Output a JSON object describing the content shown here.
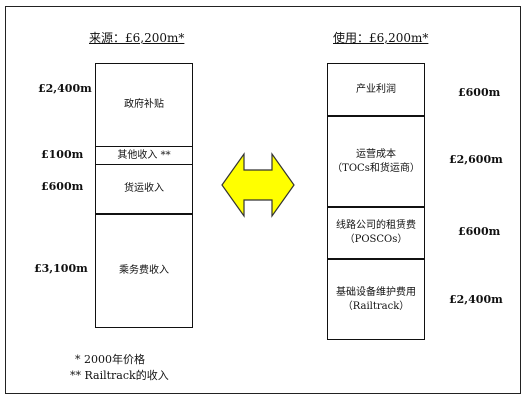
{
  "source": {
    "title": "来源：£6,200m*",
    "segments": [
      {
        "label": "政府补贴",
        "amount": "£2,400m"
      },
      {
        "label": "其他收入 **",
        "amount": "£100m"
      },
      {
        "label": "货运收入",
        "amount": "£600m"
      },
      {
        "label": "乘务费收入",
        "amount": "£3,100m"
      }
    ]
  },
  "use": {
    "title": "使用：£6,200m*",
    "segments": [
      {
        "label": "产业利润",
        "sublabel": "",
        "amount": "£600m"
      },
      {
        "label": "运营成本",
        "sublabel": "（TOCs和货运商）",
        "amount": "£2,600m"
      },
      {
        "label": "线路公司的租赁费",
        "sublabel": "（POSCOs）",
        "amount": "£600m"
      },
      {
        "label": "基础设备维护费用",
        "sublabel": "（Railtrack）",
        "amount": "£2,400m"
      }
    ]
  },
  "arrow": {
    "color": "#ffff00",
    "stroke": "#333333"
  },
  "notes": {
    "note1": "* 2000年价格",
    "note2": "** Railtrack的收入"
  }
}
